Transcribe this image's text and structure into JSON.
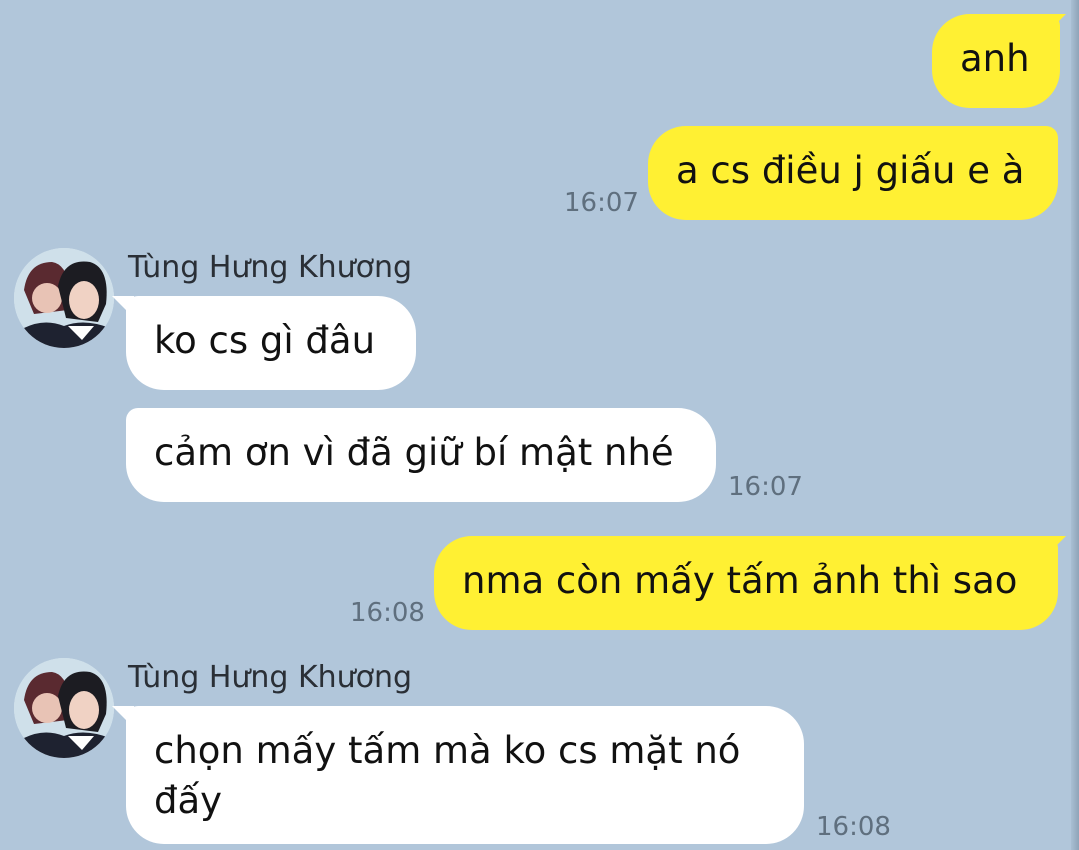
{
  "messages": [
    {
      "direction": "out",
      "text": "anh",
      "time": ""
    },
    {
      "direction": "out",
      "text": "a cs điều j giấu e à",
      "time": "16:07"
    },
    {
      "direction": "in",
      "sender": "Tùng Hưng Khương",
      "text": "ko cs gì đâu",
      "time": ""
    },
    {
      "direction": "in",
      "text": "cảm ơn vì đã giữ bí mật nhé",
      "time": "16:07"
    },
    {
      "direction": "out",
      "text": "nma còn mấy tấm ảnh thì sao",
      "time": "16:08"
    },
    {
      "direction": "in",
      "sender": "Tùng Hưng Khương",
      "text": "chọn mấy tấm mà ko cs mặt nó đấy",
      "time": "16:08"
    }
  ],
  "colors": {
    "background": "#b1c6da",
    "outgoing_bubble": "#fff033",
    "incoming_bubble": "#ffffff",
    "timestamp": "#5f6f7e"
  },
  "icons": [
    "contact-avatar"
  ]
}
